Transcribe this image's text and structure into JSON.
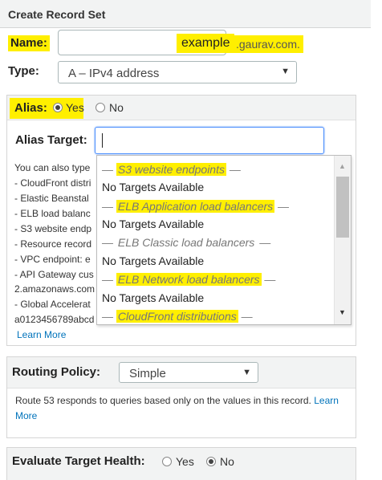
{
  "header": {
    "title": "Create Record Set"
  },
  "name": {
    "label": "Name:",
    "value": "example",
    "suffix": ".gaurav.com."
  },
  "type": {
    "label": "Type:",
    "selected": "A – IPv4 address"
  },
  "alias": {
    "label": "Alias:",
    "yes_label": "Yes",
    "no_label": "No",
    "target_label": "Alias Target:",
    "description_lines": [
      "You can also type",
      "-  CloudFront distri",
      "-  Elastic Beanstal",
      "-  ELB load balanc",
      "-  S3 website endp",
      "-  Resource record",
      "-  VPC endpoint: e",
      "-  API Gateway cus",
      "2.amazonaws.com",
      "-  Global Accelerat",
      "a0123456789abcd"
    ],
    "learn_more": "Learn More"
  },
  "dropdown": {
    "items": [
      {
        "kind": "group",
        "text": "S3 website endpoints"
      },
      {
        "kind": "option",
        "text": "No Targets Available"
      },
      {
        "kind": "group",
        "text": "ELB Application load balancers"
      },
      {
        "kind": "option",
        "text": "No Targets Available"
      },
      {
        "kind": "group",
        "text": "ELB Classic load balancers"
      },
      {
        "kind": "option",
        "text": "No Targets Available"
      },
      {
        "kind": "group",
        "text": "ELB Network load balancers"
      },
      {
        "kind": "option",
        "text": "No Targets Available"
      },
      {
        "kind": "group",
        "text": "CloudFront distributions"
      }
    ]
  },
  "routing": {
    "label": "Routing Policy:",
    "selected": "Simple",
    "description": "Route 53 responds to queries based only on the values in this record.",
    "learn_more": "Learn More"
  },
  "evaluate": {
    "label": "Evaluate Target Health:",
    "yes_label": "Yes",
    "no_label": "No"
  },
  "colors": {
    "highlight": "#ffef00",
    "link": "#0073bb",
    "panel_header": "#f2f3f3",
    "focus_border": "#4d90fe"
  }
}
